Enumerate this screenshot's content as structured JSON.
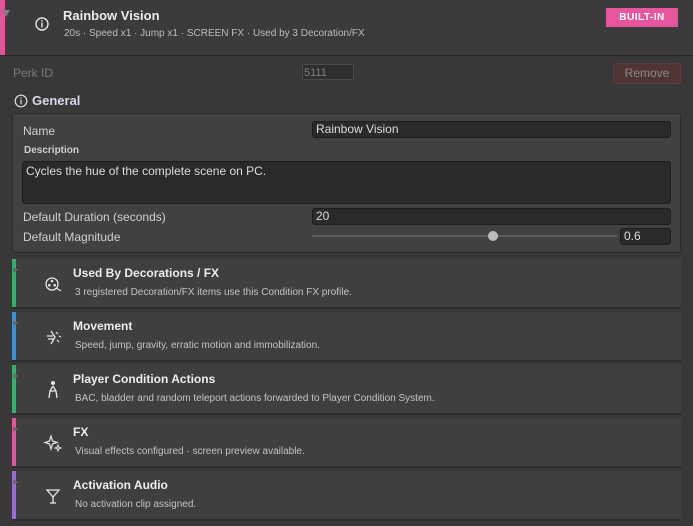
{
  "header": {
    "title": "Rainbow Vision",
    "subtitle": "20s · Speed x1 · Jump x1 · SCREEN FX · Used by 3 Decoration/FX",
    "badge": "BUILT-IN",
    "accent_color": "#e0559e",
    "icon": "info-icon"
  },
  "perk": {
    "label": "Perk ID",
    "value": "5111",
    "remove_label": "Remove"
  },
  "general": {
    "heading": "General",
    "icon": "info-icon",
    "name_label": "Name",
    "name_value": "Rainbow Vision",
    "description_label": "Description",
    "description_value": "Cycles the hue of the complete scene on PC.",
    "duration_label": "Default Duration (seconds)",
    "duration_value": "20",
    "magnitude_label": "Default Magnitude",
    "magnitude_value": "0.6"
  },
  "sections": [
    {
      "title": "Used By Decorations / FX",
      "description": "3 registered Decoration/FX items use this Condition FX profile.",
      "color": "#2fb36a",
      "icon": "film-reel-icon"
    },
    {
      "title": "Movement",
      "description": "Speed, jump, gravity, erratic motion and immobilization.",
      "color": "#3d8fd9",
      "icon": "motion-burst-icon"
    },
    {
      "title": "Player Condition Actions",
      "description": "BAC, bladder and random teleport actions forwarded to Player Condition System.",
      "color": "#2fb36a",
      "icon": "person-icon"
    },
    {
      "title": "FX",
      "description": "Visual effects configured · screen preview available.",
      "color": "#e0559e",
      "icon": "sparkle-icon"
    },
    {
      "title": "Activation Audio",
      "description": "No activation clip assigned.",
      "color": "#9a6ad6",
      "icon": "cocktail-glass-icon"
    }
  ]
}
